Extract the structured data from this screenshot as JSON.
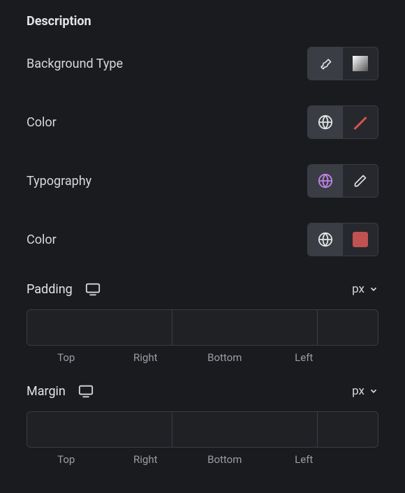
{
  "section": {
    "title": "Description"
  },
  "bgType": {
    "label": "Background Type"
  },
  "color1": {
    "label": "Color"
  },
  "typography": {
    "label": "Typography"
  },
  "color2": {
    "label": "Color",
    "value": "#c15252"
  },
  "padding": {
    "label": "Padding",
    "unit": "px",
    "top": "",
    "right": "",
    "bottom": "",
    "left": "",
    "labels": {
      "top": "Top",
      "right": "Right",
      "bottom": "Bottom",
      "left": "Left"
    }
  },
  "margin": {
    "label": "Margin",
    "unit": "px",
    "top": "",
    "right": "",
    "bottom": "",
    "left": "",
    "labels": {
      "top": "Top",
      "right": "Right",
      "bottom": "Bottom",
      "left": "Left"
    }
  }
}
